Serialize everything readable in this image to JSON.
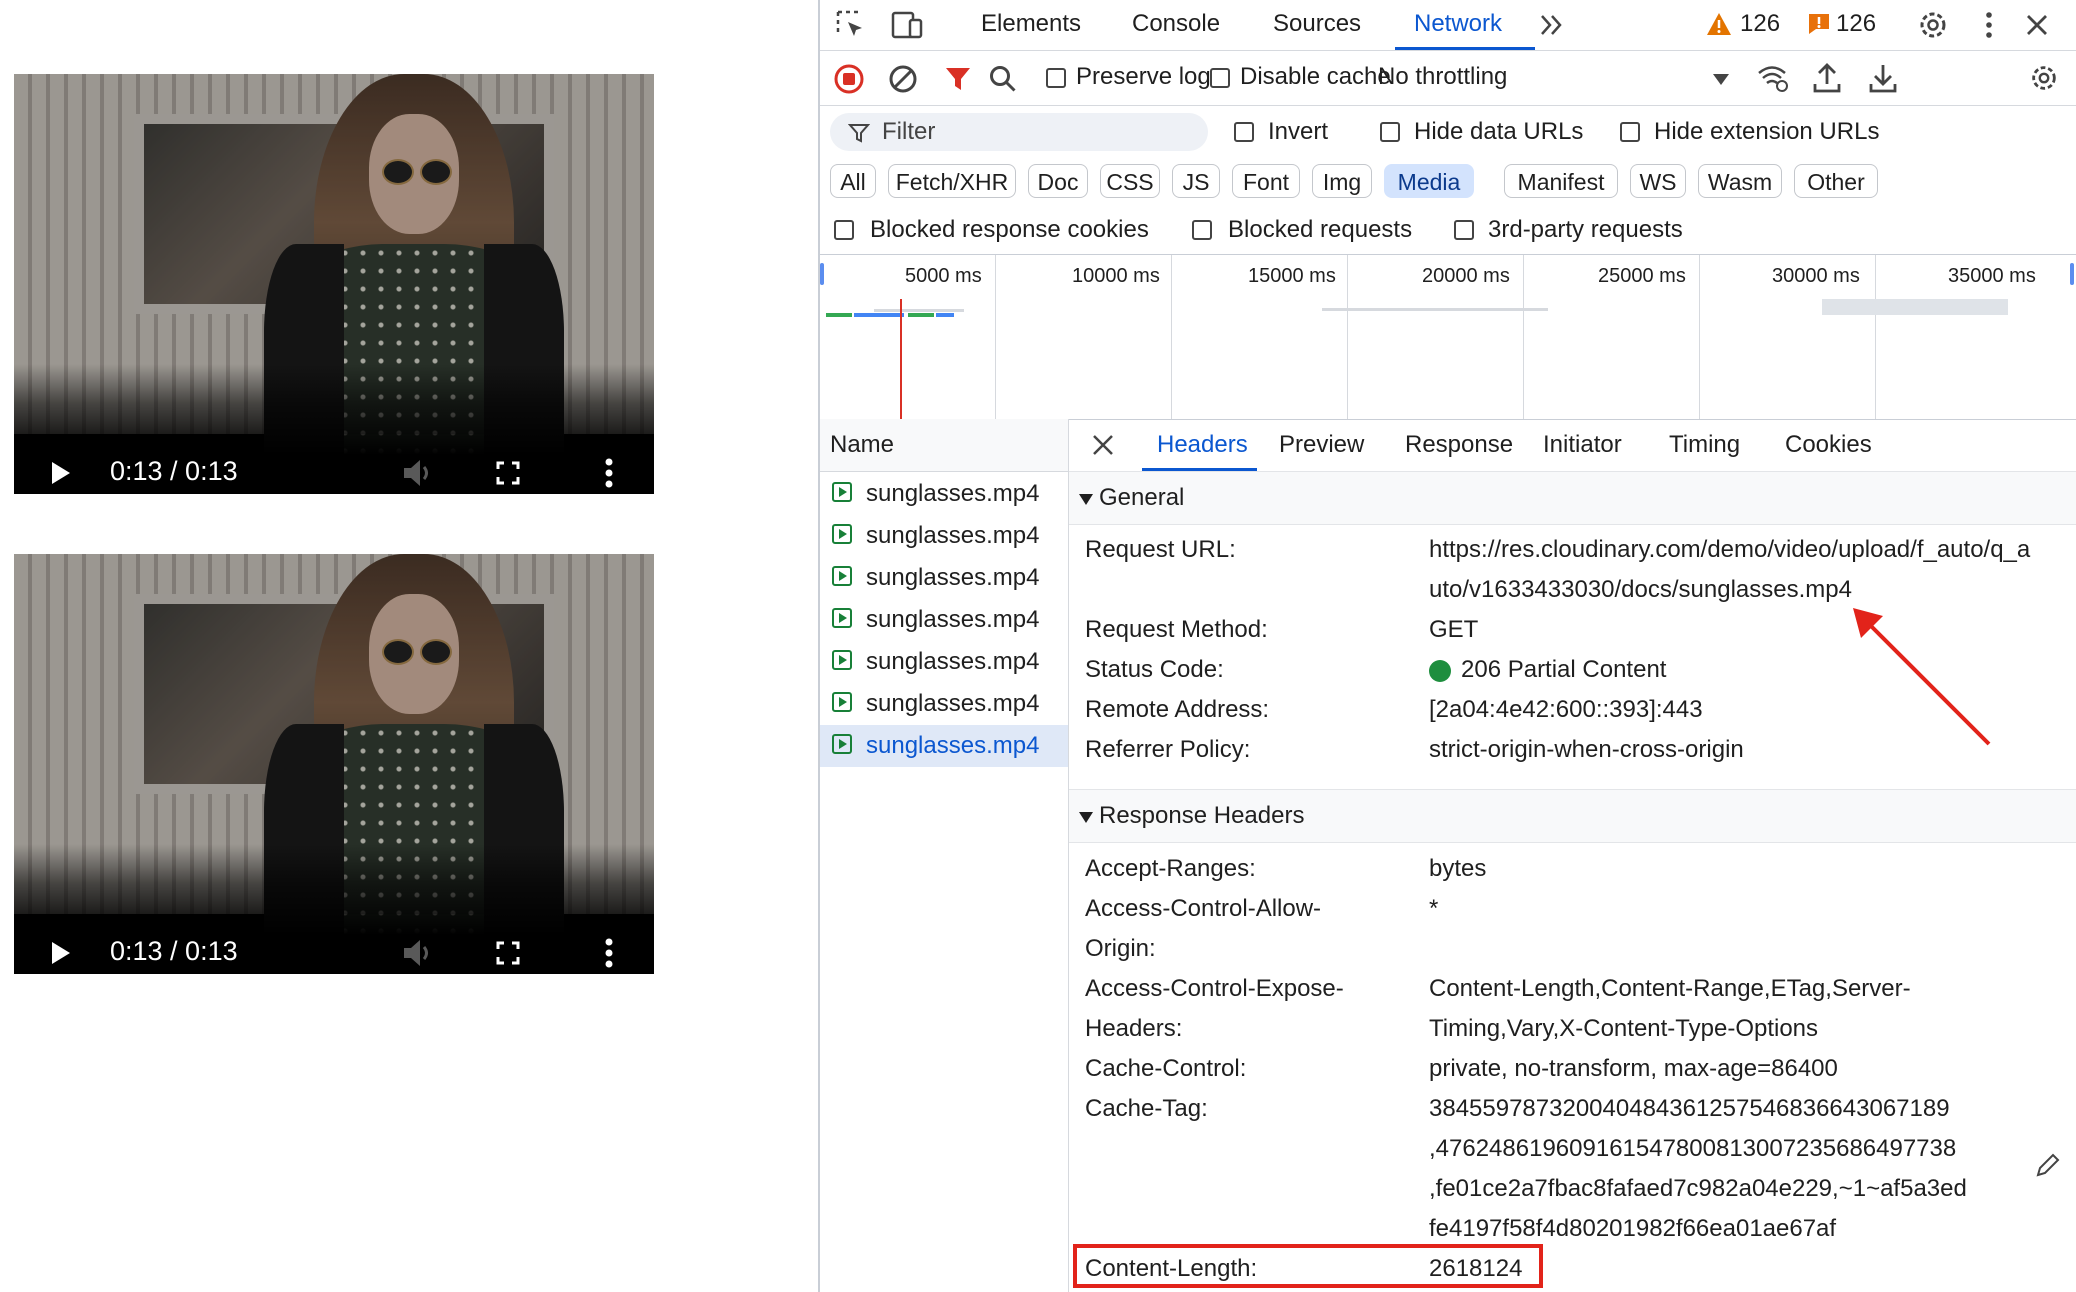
{
  "players": [
    {
      "time": "0:13 / 0:13",
      "progress": 1.0
    },
    {
      "time": "0:13 / 0:13",
      "progress": 1.0
    }
  ],
  "devtools": {
    "tabs": [
      "Elements",
      "Console",
      "Sources",
      "Network"
    ],
    "active_tab": "Network",
    "warnings_count": "126",
    "issues_count": "126",
    "toolbar": {
      "preserve_log": "Preserve log",
      "disable_cache": "Disable cache",
      "throttling": "No throttling"
    },
    "filter": {
      "placeholder": "Filter",
      "invert": "Invert",
      "hide_data_urls": "Hide data URLs",
      "hide_extension_urls": "Hide extension URLs"
    },
    "type_chips": [
      "All",
      "Fetch/XHR",
      "Doc",
      "CSS",
      "JS",
      "Font",
      "Img",
      "Media",
      "Manifest",
      "WS",
      "Wasm",
      "Other"
    ],
    "active_chip": "Media",
    "blocked": {
      "cookies": "Blocked response cookies",
      "requests": "Blocked requests",
      "third_party": "3rd-party requests"
    },
    "timeline_labels": [
      "5000 ms",
      "10000 ms",
      "15000 ms",
      "20000 ms",
      "25000 ms",
      "30000 ms",
      "35000 ms"
    ],
    "name_header": "Name",
    "requests": [
      "sunglasses.mp4",
      "sunglasses.mp4",
      "sunglasses.mp4",
      "sunglasses.mp4",
      "sunglasses.mp4",
      "sunglasses.mp4",
      "sunglasses.mp4"
    ],
    "detail_tabs": [
      "Headers",
      "Preview",
      "Response",
      "Initiator",
      "Timing",
      "Cookies"
    ],
    "active_detail_tab": "Headers",
    "general": {
      "title": "General",
      "request_url_key": "Request URL:",
      "request_url_line1": "https://res.cloudinary.com/demo/video/upload/f_auto/q_a",
      "request_url_line2": "uto/v1633433030/docs/sunglasses.mp4",
      "method_key": "Request Method:",
      "method": "GET",
      "status_key": "Status Code:",
      "status": "206 Partial Content",
      "remote_key": "Remote Address:",
      "remote": "[2a04:4e42:600::393]:443",
      "referrer_key": "Referrer Policy:",
      "referrer": "strict-origin-when-cross-origin"
    },
    "response_headers": {
      "title": "Response Headers",
      "accept_ranges_key": "Accept-Ranges:",
      "accept_ranges": "bytes",
      "acao_key_1": "Access-Control-Allow-",
      "acao_key_2": "Origin:",
      "acao": "*",
      "aceh_key_1": "Access-Control-Expose-",
      "aceh_key_2": "Headers:",
      "aceh_1": "Content-Length,Content-Range,ETag,Server-",
      "aceh_2": "Timing,Vary,X-Content-Type-Options",
      "cache_control_key": "Cache-Control:",
      "cache_control": "private, no-transform, max-age=86400",
      "cache_tag_key": "Cache-Tag:",
      "cache_tag_1": "38455978732004048436125754683664306718​9",
      "cache_tag_2": ",476248619609161547800813007235686497738",
      "cache_tag_3": ",fe01ce2a7fbac8fafaed7c982a04e229,~1~af5a3ed",
      "cache_tag_4": "fe4197f58f4d80201982f66ea01ae67af",
      "content_length_key": "Content-Length:",
      "content_length": "2618124"
    }
  },
  "colors": {
    "accent": "#0b57d0",
    "highlight": "#e2231a",
    "status_ok": "#1e8e3e"
  }
}
